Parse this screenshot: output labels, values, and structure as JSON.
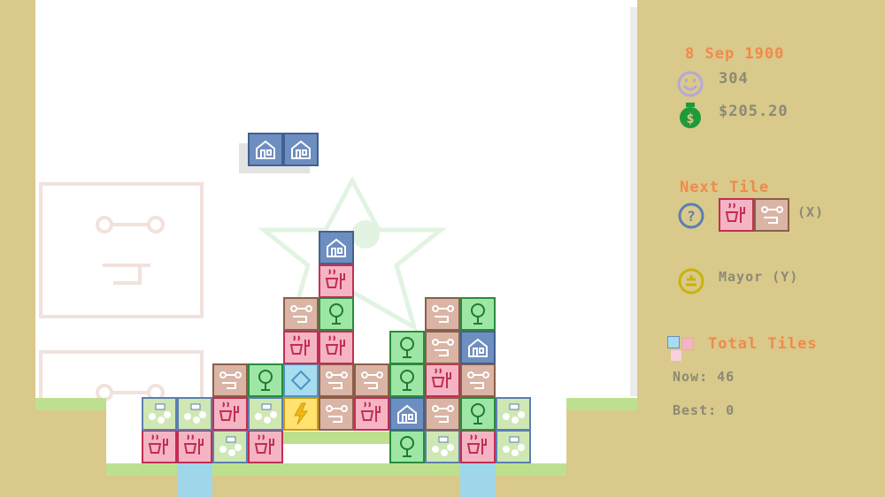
{
  "hud": {
    "date": "8 Sep 1900",
    "happiness": "304",
    "money": "$205.20",
    "next_tile_label": "Next Tile",
    "swap_key": "(X)",
    "mayor_label": "Mayor (Y)",
    "total_tiles_label": "Total Tiles",
    "now_label": "Now: 46",
    "best_label": "Best: 0"
  },
  "icons": {
    "happiness": "smiley-icon",
    "money": "money-bag-icon",
    "hold": "question-icon",
    "mayor": "mayor-icon",
    "tiles": "tiles-icon"
  },
  "colors": {
    "sand": "#d9c98a",
    "accent": "#f08a4b",
    "label_grey": "#8a8a76",
    "house": "#6d8ec0",
    "food": "#f4b4c4",
    "tool": "#dab4a5",
    "tree": "#9ee6a6",
    "park": "#cfe7b3",
    "water": "#a8dcef",
    "power": "#ffe270"
  },
  "next_tile": [
    "food",
    "tool"
  ],
  "falling_piece": [
    "house",
    "house"
  ]
}
